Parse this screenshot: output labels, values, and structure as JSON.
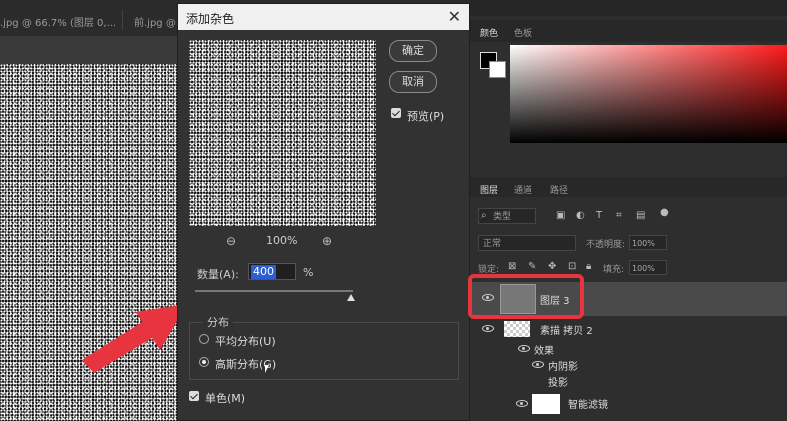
{
  "document_tabs": [
    {
      "label": ".jpg @ 66.7% (图层 0,..."
    },
    {
      "label": "前.jpg @ 66."
    }
  ],
  "dialog": {
    "title": "添加杂色",
    "ok_label": "确定",
    "cancel_label": "取消",
    "preview_label": "预览(P)",
    "zoom_level": "100%",
    "amount_label": "数量(A):",
    "amount_value": "400",
    "amount_unit": "%",
    "amount_slider_fraction": 0.95,
    "distribution_label": "分布",
    "uniform_label": "平均分布(U)",
    "gaussian_label": "高斯分布(G)",
    "selected_distribution": "gaussian",
    "monochrome_label": "单色(M)",
    "monochrome_checked": true,
    "preview_checked": true
  },
  "color_panel": {
    "tabs": [
      "颜色",
      "色板"
    ],
    "foreground": "#000000",
    "background": "#ffffff",
    "hue_color": "#ff1a1a"
  },
  "layers_panel": {
    "tabs": [
      "图层",
      "通道",
      "路径"
    ],
    "filter_label": "类型",
    "blend_mode": "正常",
    "opacity_label": "不透明度:",
    "opacity_value": "100%",
    "lock_label": "锁定:",
    "fill_label": "填充:",
    "fill_value": "100%",
    "layers": [
      {
        "name": "图层 3",
        "selected": true
      },
      {
        "name": "素描 拷贝 2"
      },
      {
        "name": "效果"
      },
      {
        "name": "内阴影"
      },
      {
        "name": "投影"
      },
      {
        "name": "智能滤镜"
      }
    ]
  },
  "colors": {
    "highlight": "#e8343f"
  }
}
